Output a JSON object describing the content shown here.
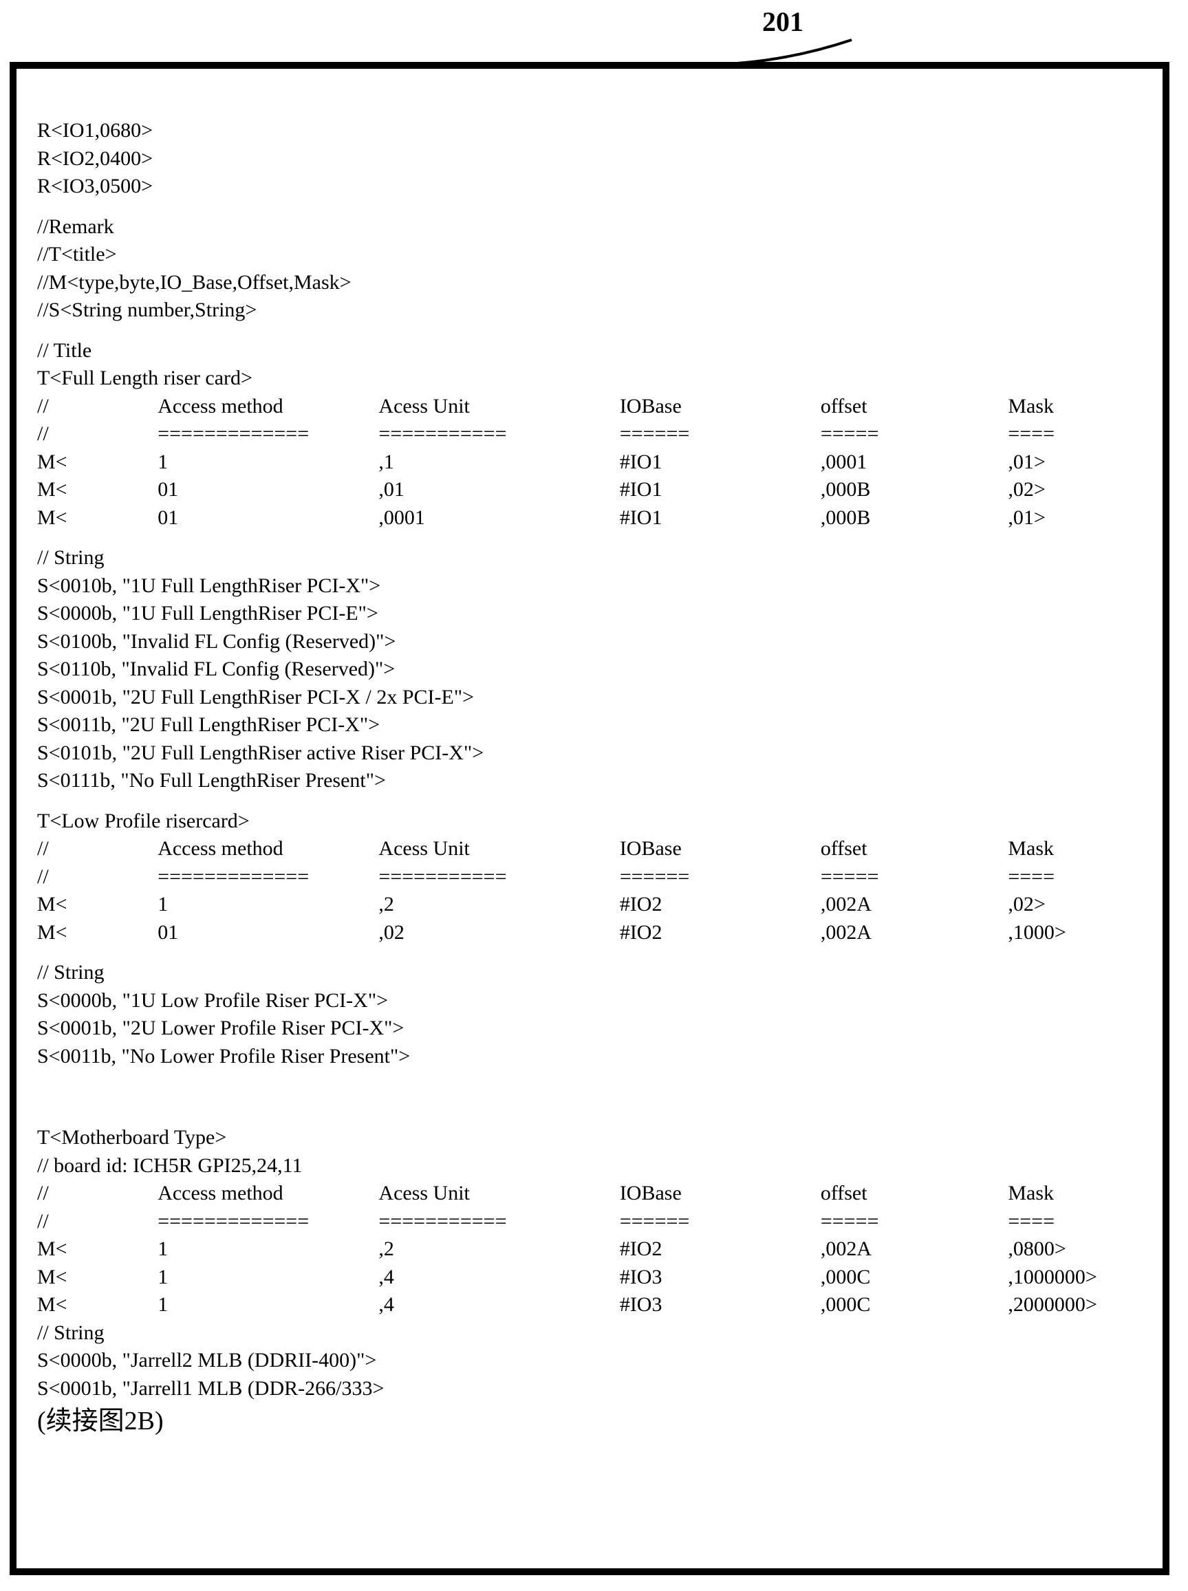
{
  "figureLabel": "201",
  "rLines": [
    "R<IO1,0680>",
    "R<IO2,0400>",
    "R<IO3,0500>"
  ],
  "remarkHeader": "//Remark",
  "remarkLines": [
    "//T<title>",
    "//M<type,byte,IO_Base,Offset,Mask>",
    "//S<String number,String>"
  ],
  "titleHeader": "// Title",
  "table1": {
    "title": "T<Full Length riser card>",
    "header": {
      "c0": "//",
      "c1": "Access method",
      "c2": "Acess Unit",
      "c3": "IOBase",
      "c4": "offset",
      "c5": "Mask"
    },
    "sep": {
      "c0": "//",
      "c1": "=============",
      "c2": "===========",
      "c3": "======",
      "c4": "=====",
      "c5": "===="
    },
    "rows": [
      {
        "c0": "M<",
        "c1": "1",
        "c2": ",1",
        "c3": "#IO1",
        "c4": ",0001",
        "c5": ",01>"
      },
      {
        "c0": "M<",
        "c1": "01",
        "c2": ",01",
        "c3": "#IO1",
        "c4": ",000B",
        "c5": ",02>"
      },
      {
        "c0": "M<",
        "c1": "01",
        "c2": ",0001",
        "c3": "#IO1",
        "c4": ",000B",
        "c5": ",01>"
      }
    ]
  },
  "strings1Header": "// String",
  "strings1": [
    "S<0010b, \"1U Full LengthRiser PCI-X\">",
    "S<0000b, \"1U Full LengthRiser PCI-E\">",
    "S<0100b, \"Invalid FL Config (Reserved)\">",
    "S<0110b, \"Invalid FL Config (Reserved)\">",
    "S<0001b, \"2U Full LengthRiser PCI-X / 2x PCI-E\">",
    "S<0011b, \"2U Full LengthRiser PCI-X\">",
    "S<0101b, \"2U Full LengthRiser active Riser PCI-X\">",
    "S<0111b, \"No Full LengthRiser Present\">"
  ],
  "table2": {
    "title": "T<Low Profile risercard>",
    "header": {
      "c0": "//",
      "c1": "Access method",
      "c2": "Acess Unit",
      "c3": "IOBase",
      "c4": "offset",
      "c5": "Mask"
    },
    "sep": {
      "c0": "//",
      "c1": "=============",
      "c2": "===========",
      "c3": "======",
      "c4": "=====",
      "c5": "===="
    },
    "rows": [
      {
        "c0": "M<",
        "c1": "1",
        "c2": ",2",
        "c3": "#IO2",
        "c4": ",002A",
        "c5": ",02>"
      },
      {
        "c0": "M<",
        "c1": "01",
        "c2": ",02",
        "c3": "#IO2",
        "c4": ",002A",
        "c5": ",1000>"
      }
    ]
  },
  "strings2Header": "// String",
  "strings2": [
    "S<0000b, \"1U Low Profile Riser PCI-X\">",
    "S<0001b, \"2U Lower Profile Riser PCI-X\">",
    "S<0011b, \"No Lower Profile Riser Present\">"
  ],
  "table3": {
    "title": "T<Motherboard Type>",
    "subtitle": "// board id: ICH5R GPI25,24,11",
    "header": {
      "c0": "//",
      "c1": "Access method",
      "c2": "Acess Unit",
      "c3": "IOBase",
      "c4": "offset",
      "c5": "Mask"
    },
    "sep": {
      "c0": "//",
      "c1": "=============",
      "c2": "===========",
      "c3": "======",
      "c4": "=====",
      "c5": "===="
    },
    "rows": [
      {
        "c0": "M<",
        "c1": "1",
        "c2": ",2",
        "c3": "#IO2",
        "c4": ",002A",
        "c5": ",0800>"
      },
      {
        "c0": "M<",
        "c1": "1",
        "c2": ",4",
        "c3": "#IO3",
        "c4": ",000C",
        "c5": ",1000000>"
      },
      {
        "c0": "M<",
        "c1": "1",
        "c2": ",4",
        "c3": "#IO3",
        "c4": ",000C",
        "c5": ",2000000>"
      }
    ]
  },
  "strings3Header": "// String",
  "strings3": [
    "S<0000b, \"Jarrell2 MLB (DDRII-400)\">",
    "S<0001b, \"Jarrell1 MLB (DDR-266/333>"
  ],
  "footer": "(续接图2B)"
}
